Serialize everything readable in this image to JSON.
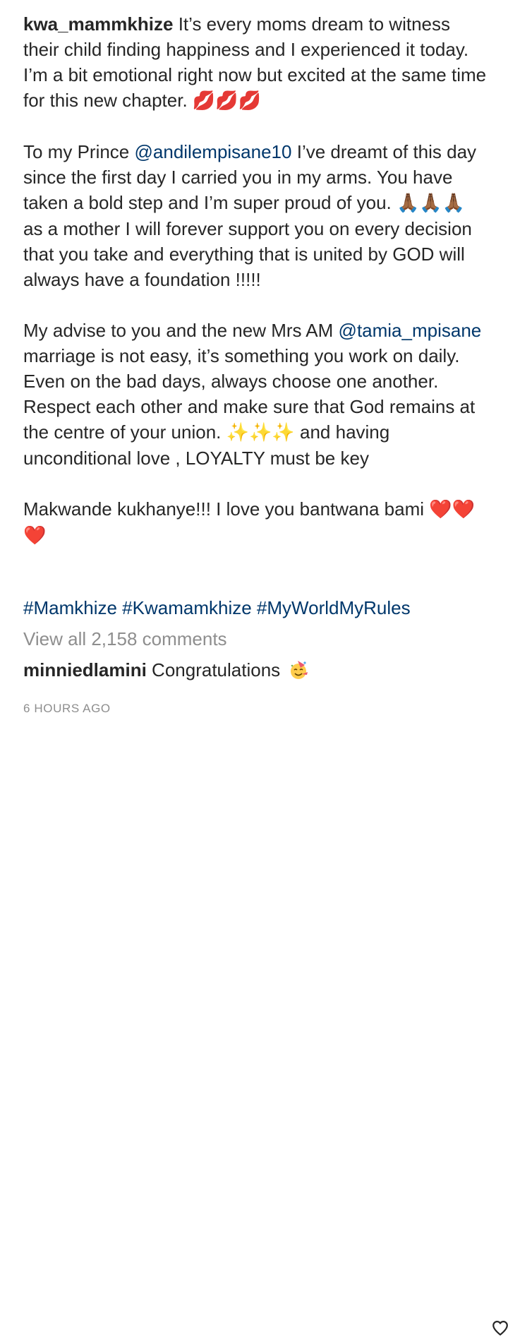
{
  "post": {
    "author": "kwa_mammkhize",
    "p1_text": "It’s every moms dream to witness their child finding happiness and I experienced it today. I’m a bit emotional right now but excited at the same time for this new chapter.",
    "p1_emoji": "💋💋💋",
    "p2_pre": "To my Prince",
    "p2_mention": "@andilempisane10",
    "p2_mid": "I’ve dreamt of this day since the first day I carried you in my arms. You have taken a bold step and I’m super proud of you.",
    "p2_emoji": "🙏🏾🙏🏾🙏🏾",
    "p2_post": "as a mother I will forever support you on every decision that you take and everything that is united by GOD will always have a foundation !!!!!",
    "p3_pre": "My advise to you and the new Mrs AM",
    "p3_mention": "@tamia_mpisane",
    "p3_mid": "marriage is not easy, it’s something you work on daily. Even on the bad days, always choose one another. Respect each other and make sure that God remains at the centre of your union.",
    "p3_emoji": "✨✨✨",
    "p3_post": "and having unconditional love , LOYALTY must be key",
    "p4_text": "Makwande kukhanye!!! I love you bantwana bami",
    "p4_emoji": "❤️❤️❤️",
    "hashtags": [
      "#Mamkhize",
      "#Kwamamkhize",
      "#MyWorldMyRules"
    ]
  },
  "comments": {
    "view_all_label": "View all 2,158 comments",
    "items": [
      {
        "username": "minniedlamini",
        "text": "Congratulations",
        "emoji": "partying-face-icon"
      }
    ]
  },
  "timestamp": "6 HOURS AGO",
  "colors": {
    "text": "#262626",
    "link": "#00376b",
    "muted": "#8e8e8e"
  }
}
